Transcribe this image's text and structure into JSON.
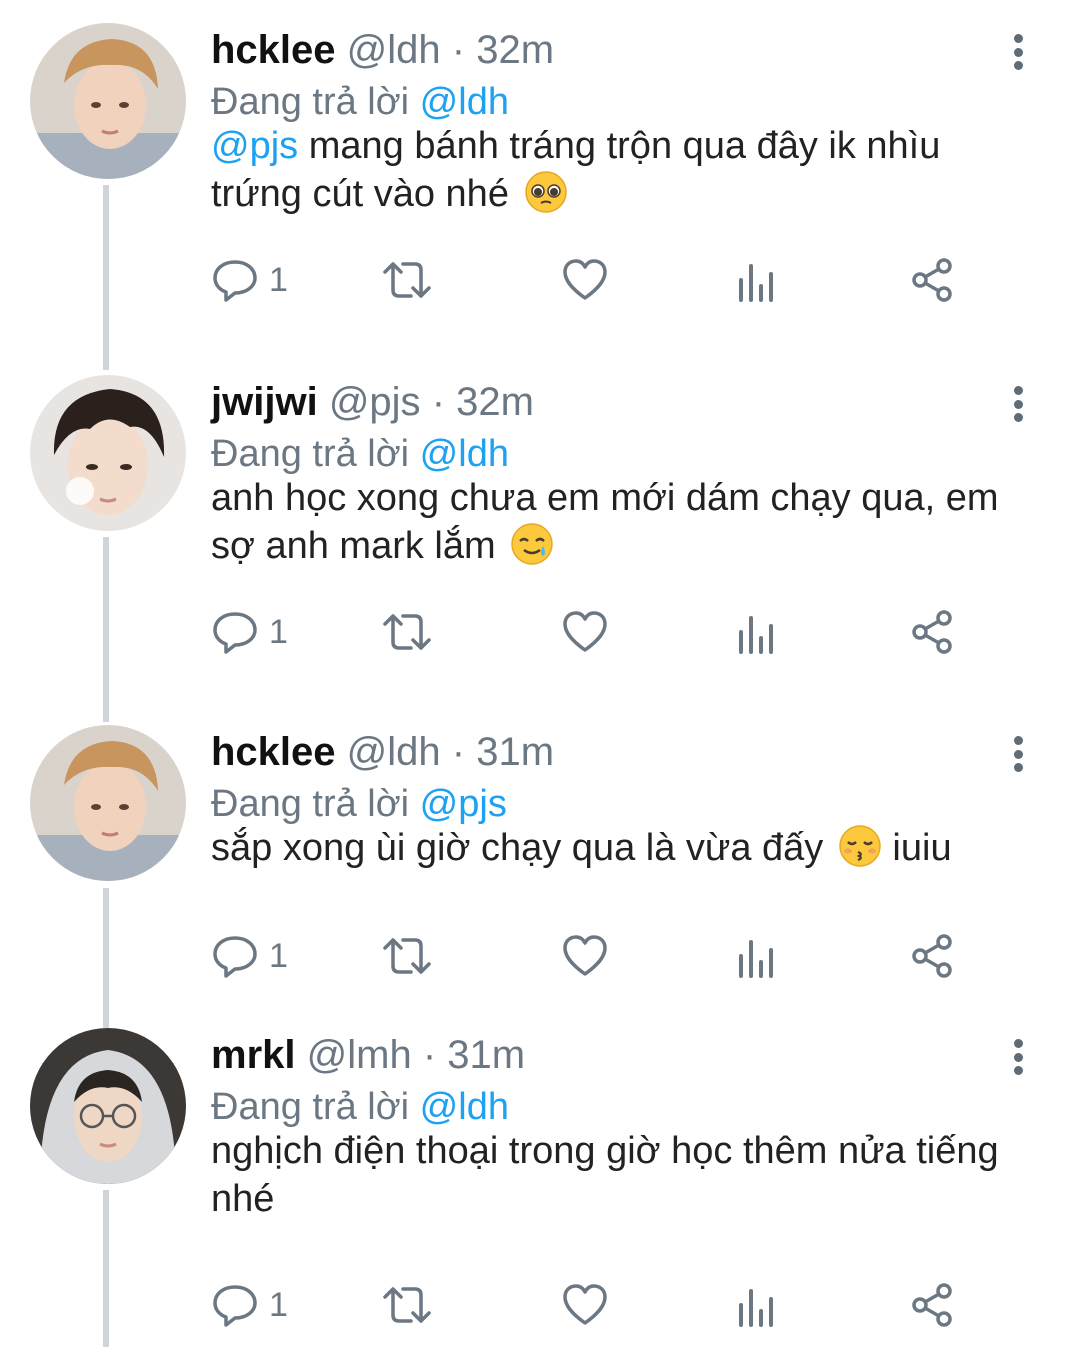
{
  "colors": {
    "mention": "#1da1f2",
    "meta": "#6b7782",
    "thread_line": "#cfd5db",
    "icon": "#6b7782"
  },
  "tweets": [
    {
      "name": "hcklee",
      "handle": "@ldh",
      "sep": "·",
      "time": "32m",
      "reply_prefix": "Đang trả lời",
      "reply_to": "@ldh",
      "mention": "@pjs",
      "text": "mang bánh tráng trộn qua đây ik nhìu trứng cút vào nhé",
      "emoji": "pleading-face",
      "text_after": "",
      "reply_count": "1",
      "avatar": "avatar-photo-blond"
    },
    {
      "name": "jwijwi",
      "handle": "@pjs",
      "sep": "·",
      "time": "32m",
      "reply_prefix": "Đang trả lời",
      "reply_to": "@ldh",
      "mention": "",
      "text": "anh học xong chưa em mới dám chạy qua, em sợ anh mark lắm",
      "emoji": "smiling-face-with-tear",
      "text_after": "",
      "reply_count": "1",
      "avatar": "avatar-photo-dark-hair"
    },
    {
      "name": "hcklee",
      "handle": "@ldh",
      "sep": "·",
      "time": "31m",
      "reply_prefix": "Đang trả lời",
      "reply_to": "@pjs",
      "mention": "",
      "text": "sắp xong ùi giờ chạy qua là vừa đấy",
      "emoji": "kissing-face",
      "text_after": "iuiu",
      "reply_count": "1",
      "avatar": "avatar-photo-blond"
    },
    {
      "name": "mrkl",
      "handle": "@lmh",
      "sep": "·",
      "time": "31m",
      "reply_prefix": "Đang trả lời",
      "reply_to": "@ldh",
      "mention": "",
      "text": "nghịch điện thoại trong giờ học thêm nửa tiếng nhé",
      "emoji": "",
      "text_after": "",
      "reply_count": "1",
      "avatar": "avatar-photo-hoodie"
    }
  ],
  "icons": {
    "reply": "reply-icon",
    "retweet": "retweet-icon",
    "like": "heart-icon",
    "analytics": "analytics-icon",
    "share": "share-icon",
    "more": "more-vertical-icon"
  }
}
